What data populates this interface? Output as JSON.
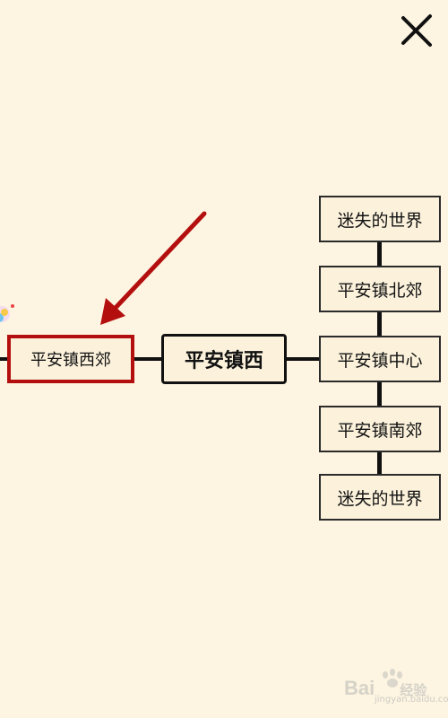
{
  "close_icon": "close-icon",
  "center_node": {
    "label": "平安镇西"
  },
  "left_node": {
    "label": "平安镇西郊"
  },
  "right_nodes": [
    {
      "label": "迷失的世界"
    },
    {
      "label": "平安镇北郊"
    },
    {
      "label": "平安镇中心"
    },
    {
      "label": "平安镇南郊"
    },
    {
      "label": "迷失的世界"
    }
  ],
  "highlight_color": "#b40f0f",
  "background_color": "#fdf5e1",
  "watermark": {
    "brand": "Bai",
    "brand2": "经验",
    "sub": "jingyan.baidu.com"
  }
}
